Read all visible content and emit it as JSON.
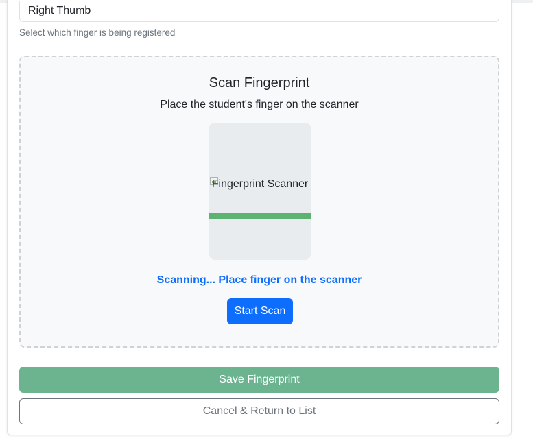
{
  "finger_select": {
    "value": "Right Thumb",
    "help_text": "Select which finger is being registered"
  },
  "scan_panel": {
    "title": "Scan Fingerprint",
    "subtitle": "Place the student's finger on the scanner",
    "scanner_image_alt": "Fingerprint Scanner",
    "scan_progress_fraction": 1.0,
    "status_text": "Scanning... Place finger on the scanner",
    "start_button_label": "Start Scan"
  },
  "actions": {
    "save_label": "Save Fingerprint",
    "cancel_label": "Cancel & Return to List"
  },
  "colors": {
    "primary": "#0d6efd",
    "success_bar": "#5cb270",
    "save_button": "#6cb48f",
    "secondary": "#6c757d"
  }
}
